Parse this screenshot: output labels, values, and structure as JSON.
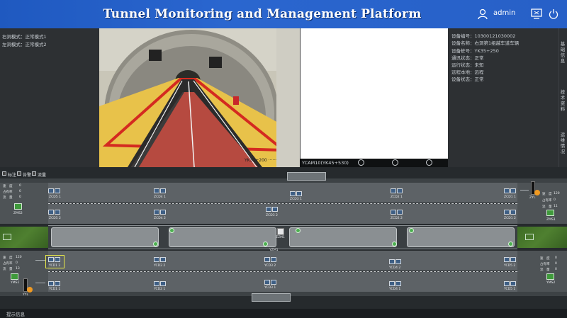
{
  "header": {
    "title": "Tunnel Monitoring and Management Platform",
    "user": "admin",
    "icons": [
      "user-icon",
      "screen-icon",
      "power-icon"
    ]
  },
  "left_info": {
    "right_mode": "右洞模式：正常模式1",
    "left_mode": "左洞模式：正常模式2"
  },
  "video": {
    "camera_label": "YCAM10(YK45+530)",
    "controls": [
      "prev-icon",
      "close-icon",
      "next-icon"
    ]
  },
  "device_info": {
    "rows": [
      "设备编号：10300121030002",
      "设备名称：右洞第1组越车道车辆",
      "设备桩号：YK35+250",
      "通讯状态：正常",
      "运行状态：未知",
      "远程本地：远程",
      "设备状态：正常"
    ]
  },
  "side_tabs": [
    "基础信息",
    "技术资料",
    "运维情况"
  ],
  "legend": {
    "items": [
      "标注",
      "告警",
      "流量"
    ]
  },
  "road_map": {
    "devices": {
      "zcd_1": [
        "ZCD5 1",
        "ZCD4 1",
        "ZCD3 1",
        "ZCD2 1",
        "ZCD1 1"
      ],
      "zcd_2": [
        "ZCD5 2",
        "ZCD4 2",
        "ZCD3 2",
        "ZCD2 2",
        "ZCD1 2"
      ],
      "ycd_2": [
        "YCD1 2",
        "YCD2 2",
        "YCD3 2",
        "YCD4 2",
        "YCD5 2"
      ],
      "ycd_1": [
        "YCD1 1",
        "YCD2 1",
        "YCD3 1",
        "YCD4 1",
        "YCD5 1"
      ],
      "zsign": "ZMS2",
      "zsign_right": "ZMS1",
      "ysign": "YMS1",
      "ysign_right": "YMS2",
      "traffic_light_right": "ZYL",
      "traffic_light_left": "YYL",
      "center_device_1": "ZZM1",
      "center_device_2": "YZM1"
    },
    "left_stats": {
      "zuo_1": "速　度",
      "zuo_2": "占有率",
      "zuo_3": "流　量",
      "zuo_v1": "0",
      "zuo_v2": "0",
      "zuo_v3": "0",
      "you_1": "速　度",
      "you_2": "占有率",
      "you_3": "流　量",
      "you_v1": "120",
      "you_v2": "0",
      "you_v3": "13"
    },
    "right_stats": {
      "top_1": "速　度",
      "top_2": "占有率",
      "top_3": "流　量",
      "top_v1": "120",
      "top_v2": "0",
      "top_v3": "11",
      "bot_1": "速　度",
      "bot_2": "占有率",
      "bot_3": "流　量",
      "bot_v1": "0",
      "bot_v2": "0",
      "bot_v3": "0"
    }
  },
  "footer": {
    "text": "提示信息"
  },
  "colors": {
    "header": "#2a66cf",
    "lane": "#5d6266",
    "grass": "#4f8030",
    "badge": "#4caf50",
    "selected": "#e8e84a"
  }
}
